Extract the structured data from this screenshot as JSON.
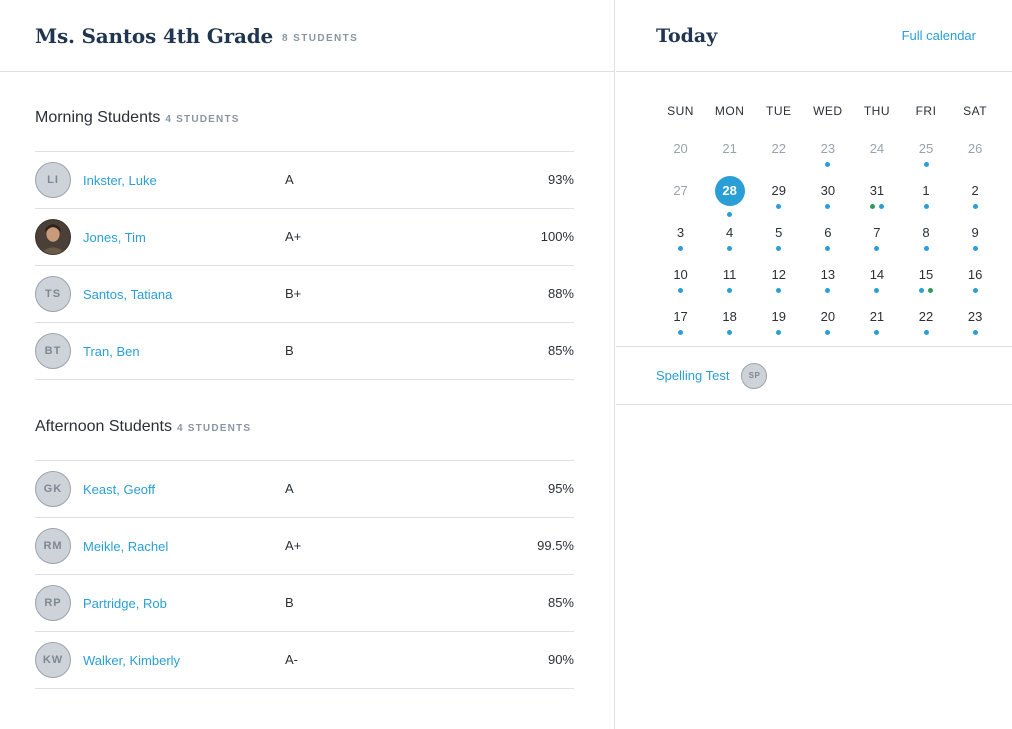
{
  "class": {
    "title": "Ms. Santos 4th Grade",
    "count": "8 STUDENTS"
  },
  "sections": [
    {
      "title": "Morning Students",
      "count": "4 STUDENTS",
      "students": [
        {
          "initials": "LI",
          "name": "Inkster, Luke",
          "grade": "A",
          "pct": "93%",
          "photo": false
        },
        {
          "initials": "",
          "name": "Jones, Tim",
          "grade": "A+",
          "pct": "100%",
          "photo": true
        },
        {
          "initials": "TS",
          "name": "Santos, Tatiana",
          "grade": "B+",
          "pct": "88%",
          "photo": false
        },
        {
          "initials": "BT",
          "name": "Tran, Ben",
          "grade": "B",
          "pct": "85%",
          "photo": false
        }
      ]
    },
    {
      "title": "Afternoon Students",
      "count": "4 STUDENTS",
      "students": [
        {
          "initials": "GK",
          "name": "Keast, Geoff",
          "grade": "A",
          "pct": "95%",
          "photo": false
        },
        {
          "initials": "RM",
          "name": "Meikle, Rachel",
          "grade": "A+",
          "pct": "99.5%",
          "photo": false
        },
        {
          "initials": "RP",
          "name": "Partridge, Rob",
          "grade": "B",
          "pct": "85%",
          "photo": false
        },
        {
          "initials": "KW",
          "name": "Walker, Kimberly",
          "grade": "A-",
          "pct": "90%",
          "photo": false
        }
      ]
    }
  ],
  "today": {
    "title": "Today",
    "full_calendar": "Full calendar"
  },
  "calendar": {
    "weekdays": [
      "SUN",
      "MON",
      "TUE",
      "WED",
      "THU",
      "FRI",
      "SAT"
    ],
    "weeks": [
      [
        {
          "d": "20",
          "m": true,
          "dots": []
        },
        {
          "d": "21",
          "m": true,
          "dots": []
        },
        {
          "d": "22",
          "m": true,
          "dots": []
        },
        {
          "d": "23",
          "m": true,
          "dots": [
            "blue"
          ]
        },
        {
          "d": "24",
          "m": true,
          "dots": []
        },
        {
          "d": "25",
          "m": true,
          "dots": [
            "blue"
          ]
        },
        {
          "d": "26",
          "m": true,
          "dots": []
        }
      ],
      [
        {
          "d": "27",
          "m": true,
          "dots": []
        },
        {
          "d": "28",
          "today": true,
          "dots": [
            "blue"
          ]
        },
        {
          "d": "29",
          "dots": [
            "blue"
          ]
        },
        {
          "d": "30",
          "dots": [
            "blue"
          ]
        },
        {
          "d": "31",
          "dots": [
            "green",
            "blue"
          ]
        },
        {
          "d": "1",
          "dots": [
            "blue"
          ]
        },
        {
          "d": "2",
          "dots": [
            "blue"
          ]
        }
      ],
      [
        {
          "d": "3",
          "dots": [
            "blue"
          ]
        },
        {
          "d": "4",
          "dots": [
            "blue"
          ]
        },
        {
          "d": "5",
          "dots": [
            "blue"
          ]
        },
        {
          "d": "6",
          "dots": [
            "blue"
          ]
        },
        {
          "d": "7",
          "dots": [
            "blue"
          ]
        },
        {
          "d": "8",
          "dots": [
            "blue"
          ]
        },
        {
          "d": "9",
          "dots": [
            "blue"
          ]
        }
      ],
      [
        {
          "d": "10",
          "dots": [
            "blue"
          ]
        },
        {
          "d": "11",
          "dots": [
            "blue"
          ]
        },
        {
          "d": "12",
          "dots": [
            "blue"
          ]
        },
        {
          "d": "13",
          "dots": [
            "blue"
          ]
        },
        {
          "d": "14",
          "dots": [
            "blue"
          ]
        },
        {
          "d": "15",
          "dots": [
            "blue",
            "green"
          ]
        },
        {
          "d": "16",
          "dots": [
            "blue"
          ]
        }
      ],
      [
        {
          "d": "17",
          "dots": [
            "blue"
          ]
        },
        {
          "d": "18",
          "dots": [
            "blue"
          ]
        },
        {
          "d": "19",
          "dots": [
            "blue"
          ]
        },
        {
          "d": "20",
          "dots": [
            "blue"
          ]
        },
        {
          "d": "21",
          "dots": [
            "blue"
          ]
        },
        {
          "d": "22",
          "dots": [
            "blue"
          ]
        },
        {
          "d": "23",
          "dots": [
            "blue"
          ]
        }
      ]
    ]
  },
  "events": [
    {
      "label": "Spelling Test",
      "chip": "SP"
    }
  ],
  "colors": {
    "accent": "#2a9fd6",
    "event_green": "#2e9a62",
    "heading": "#1f3550",
    "muted": "#8a95a1"
  }
}
